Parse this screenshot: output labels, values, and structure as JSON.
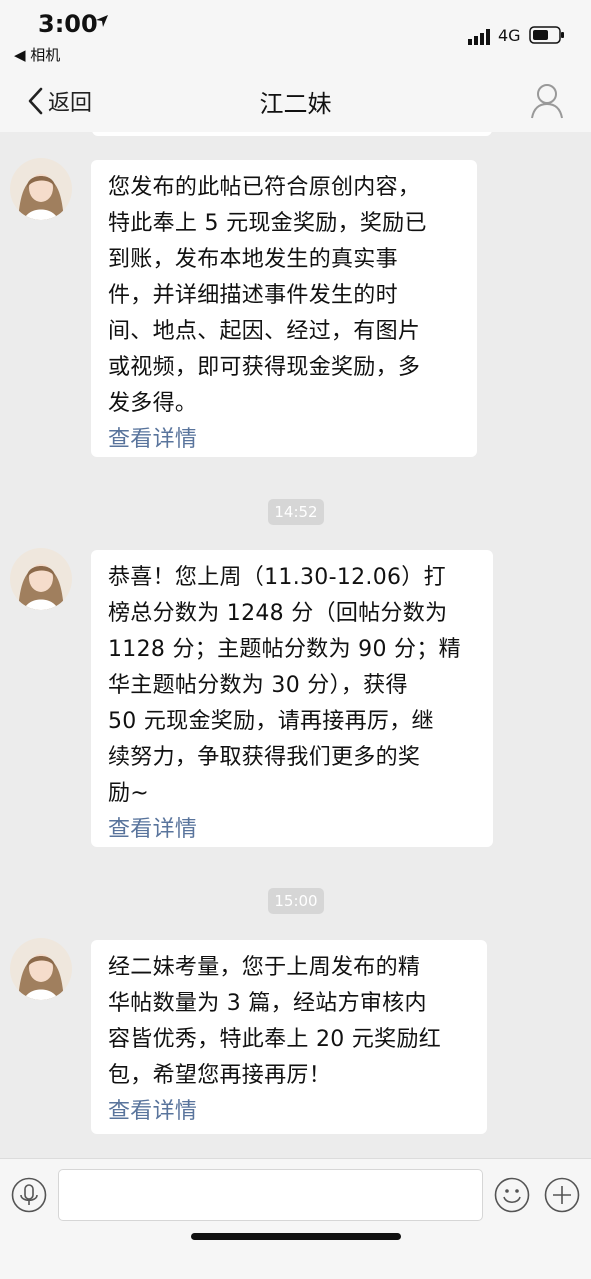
{
  "status_bar": {
    "time": "3:00",
    "back_app_label": "◀ 相机",
    "network": "4G"
  },
  "nav": {
    "back_label": "返回",
    "title": "江二妹"
  },
  "messages": [
    {
      "text": "您发布的此帖已符合原创内容，\n特此奉上 5 元现金奖励，奖励已\n到账，发布本地发生的真实事\n件，并详细描述事件发生的时\n间、地点、起因、经过，有图片\n或视频，即可获得现金奖励，多\n发多得。",
      "link": "查看详情"
    },
    {
      "timestamp": "14:52",
      "text": "恭喜！您上周（11.30-12.06）打\n榜总分数为 1248 分（回帖分数为\n1128 分；主题帖分数为 90 分；精\n华主题帖分数为 30 分），获得\n50 元现金奖励，请再接再厉，继\n续努力，争取获得我们更多的奖\n励~",
      "link": "查看详情"
    },
    {
      "timestamp": "15:00",
      "text": "经二妹考量，您于上周发布的精\n华帖数量为 3 篇，经站方审核内\n容皆优秀，特此奉上 20 元奖励红\n包，希望您再接再厉！",
      "link": "查看详情"
    }
  ],
  "input": {
    "value": ""
  },
  "colors": {
    "link": "#59749c",
    "timestamp_bg": "#d6d6d6",
    "chat_bg": "#ececec",
    "bar_bg": "#f6f6f6"
  },
  "icons": [
    "location-arrow-icon",
    "signal-icon",
    "battery-icon",
    "chevron-left-icon",
    "profile-icon",
    "voice-icon",
    "emoji-icon",
    "plus-icon"
  ]
}
